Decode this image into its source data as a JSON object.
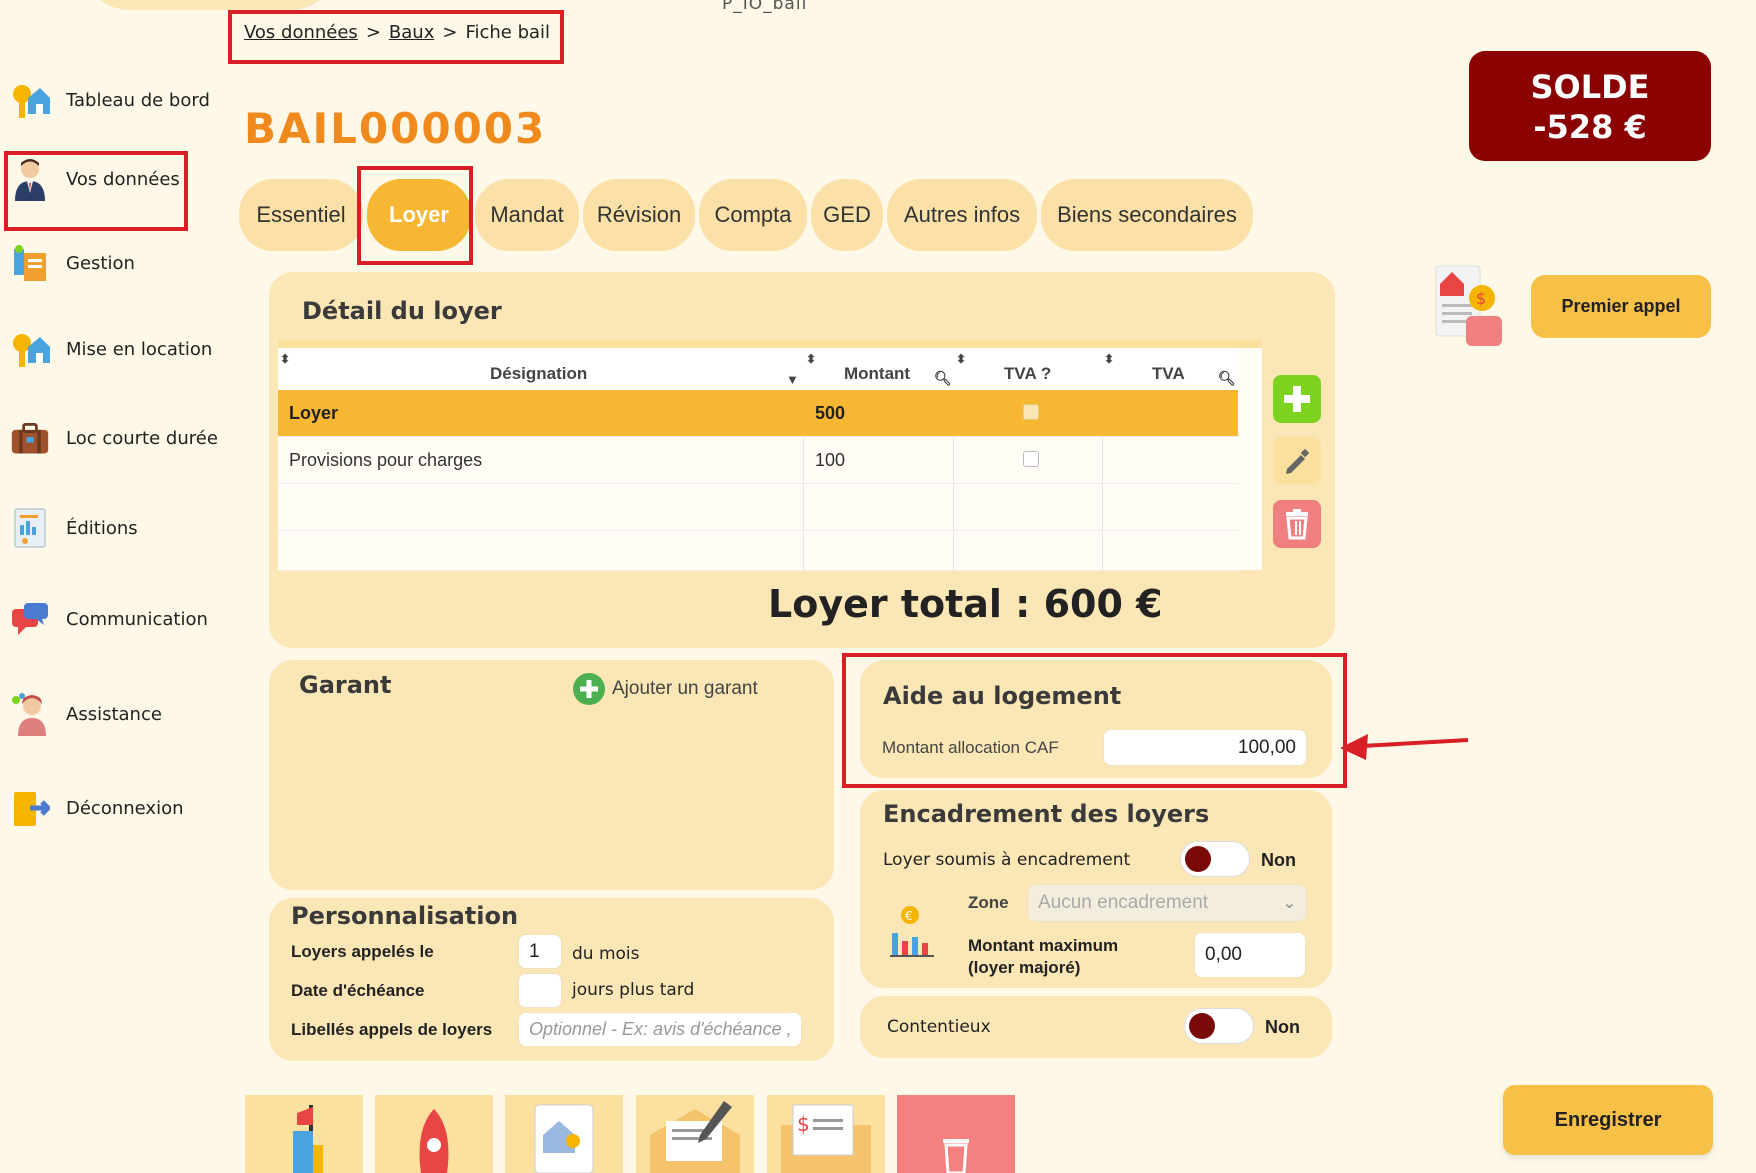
{
  "window_title": "P_IO_bail",
  "sidebar": {
    "items": [
      {
        "label": "Tableau de bord",
        "icon": "house-key-icon"
      },
      {
        "label": "Vos données",
        "icon": "user-icon"
      },
      {
        "label": "Gestion",
        "icon": "gestion-icon"
      },
      {
        "label": "Mise en location",
        "icon": "house-key-icon"
      },
      {
        "label": "Loc courte durée",
        "icon": "suitcase-icon"
      },
      {
        "label": "Éditions",
        "icon": "report-icon"
      },
      {
        "label": "Communication",
        "icon": "chat-icon"
      },
      {
        "label": "Assistance",
        "icon": "support-agent-icon"
      },
      {
        "label": "Déconnexion",
        "icon": "logout-icon"
      }
    ]
  },
  "breadcrumb": {
    "item1": "Vos données",
    "sep": ">",
    "item2": "Baux",
    "item3": "Fiche bail"
  },
  "bail_title": "BAIL000003",
  "solde": {
    "label": "SOLDE",
    "value": "-528 €"
  },
  "tabs": [
    {
      "label": "Essentiel"
    },
    {
      "label": "Loyer"
    },
    {
      "label": "Mandat"
    },
    {
      "label": "Révision"
    },
    {
      "label": "Compta"
    },
    {
      "label": "GED"
    },
    {
      "label": "Autres infos"
    },
    {
      "label": "Biens secondaires"
    }
  ],
  "premier_appel": "Premier appel",
  "loyer_detail": {
    "title": "Détail du loyer",
    "headers": {
      "designation": "Désignation",
      "montant": "Montant",
      "tva_q": "TVA ?",
      "tva": "TVA"
    },
    "rows": [
      {
        "designation": "Loyer",
        "montant": "500"
      },
      {
        "designation": "Provisions pour charges",
        "montant": "100"
      }
    ],
    "total": "Loyer total : 600 €"
  },
  "garant": {
    "title": "Garant",
    "add_label": "Ajouter un garant"
  },
  "aide": {
    "title": "Aide au logement",
    "label": "Montant allocation CAF",
    "value": "100,00"
  },
  "encadrement": {
    "title": "Encadrement des loyers",
    "soumis_label": "Loyer soumis à encadrement",
    "soumis_value": "Non",
    "zone_label": "Zone",
    "zone_value": "Aucun encadrement",
    "max_label_1": "Montant maximum",
    "max_label_2": "(loyer majoré)",
    "max_value": "0,00"
  },
  "contentieux": {
    "label": "Contentieux",
    "value": "Non"
  },
  "perso": {
    "title": "Personnalisation",
    "appeles_label": "Loyers appelés le",
    "appeles_value": "1",
    "appeles_suffix": "du mois",
    "echeance_label": "Date d'échéance",
    "echeance_value": "",
    "echeance_suffix": "jours plus tard",
    "libelles_label": "Libellés appels de loyers",
    "libelles_placeholder": "Optionnel - Ex: avis d'échéance ,"
  },
  "save": "Enregistrer",
  "colors": {
    "accent": "#f7b733",
    "orange_title": "#f08a1d",
    "solde_bg": "#8b0000",
    "panel": "#fbe7b6",
    "highlight": "#d81f26"
  }
}
